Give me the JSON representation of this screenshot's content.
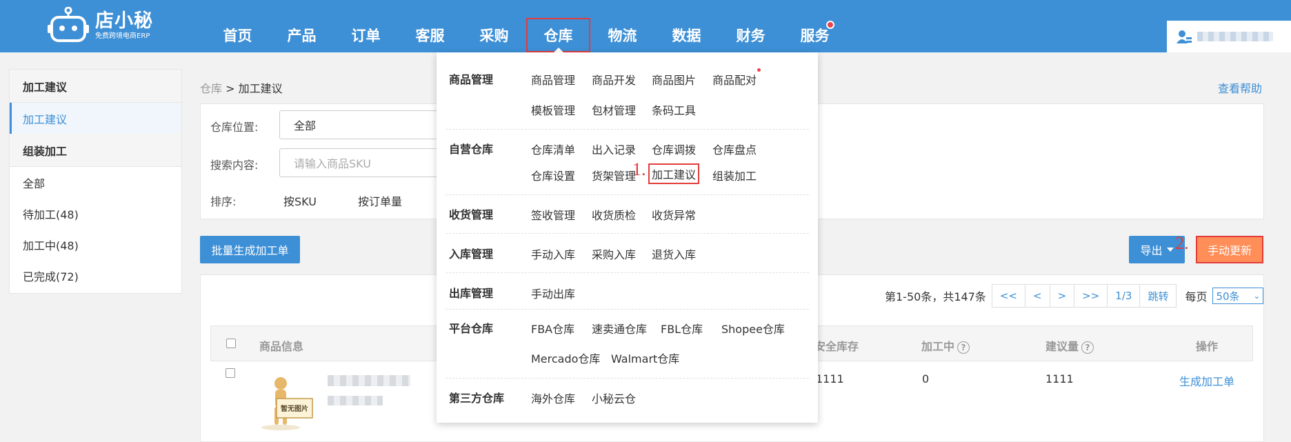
{
  "app": {
    "logo_title": "店小秘",
    "logo_subtitle": "免费跨境电商ERP"
  },
  "nav": {
    "items": [
      {
        "label": "首页"
      },
      {
        "label": "产品"
      },
      {
        "label": "订单"
      },
      {
        "label": "客服"
      },
      {
        "label": "采购"
      },
      {
        "label": "仓库",
        "active": true
      },
      {
        "label": "物流"
      },
      {
        "label": "数据"
      },
      {
        "label": "财务"
      },
      {
        "label": "服务",
        "has_dot": true
      }
    ]
  },
  "sidebar": {
    "section1_title": "加工建议",
    "item_processing_suggestion": "加工建议",
    "section2_title": "组装加工",
    "item_all": "全部",
    "item_pending": "待加工(48)",
    "item_in_progress": "加工中(48)",
    "item_done": "已完成(72)"
  },
  "breadcrumb": {
    "parent": "仓库",
    "sep": " > ",
    "current": "加工建议"
  },
  "help_link": "查看帮助",
  "filters": {
    "location_label": "仓库位置:",
    "location_value": "全部",
    "search_label": "搜索内容:",
    "search_placeholder": "请输入商品SKU",
    "sort_label": "排序:",
    "sort_by_sku": "按SKU",
    "sort_by_order": "按订单量"
  },
  "actions": {
    "batch_create": "批量生成加工单",
    "export": "导出",
    "manual_update": "手动更新",
    "annotation_1": "1.",
    "annotation_2": "2."
  },
  "pager": {
    "summary": "第1-50条，共147条",
    "first": "<<",
    "prev": "<",
    "next": ">",
    "last": ">>",
    "page": "1/3",
    "jump": "跳转",
    "per_page_label": "每页",
    "per_page_value": "50条"
  },
  "table": {
    "headers": {
      "product_info": "商品信息",
      "safety_stock": "安全库存",
      "in_processing": "加工中",
      "suggested_qty": "建议量",
      "operation": "操作"
    },
    "rows": [
      {
        "no_image_text": "暂无图片",
        "safety_stock": "1111",
        "in_processing": "0",
        "suggested_qty": "1111",
        "action": "生成加工单"
      }
    ]
  },
  "dropdown": {
    "sections": {
      "product": {
        "title": "商品管理",
        "links": [
          "商品管理",
          "商品开发",
          "商品图片",
          "商品配对",
          "模板管理",
          "包材管理",
          "条码工具"
        ]
      },
      "self_warehouse": {
        "title": "自营仓库",
        "links": [
          "仓库清单",
          "出入记录",
          "仓库调拨",
          "仓库盘点",
          "仓库设置",
          "货架管理",
          "加工建议",
          "组装加工"
        ]
      },
      "receiving": {
        "title": "收货管理",
        "links": [
          "签收管理",
          "收货质检",
          "收货异常"
        ]
      },
      "inbound": {
        "title": "入库管理",
        "links": [
          "手动入库",
          "采购入库",
          "退货入库"
        ]
      },
      "outbound": {
        "title": "出库管理",
        "links": [
          "手动出库"
        ]
      },
      "platform": {
        "title": "平台仓库",
        "links": [
          "FBA仓库",
          "速卖通仓库",
          "FBL仓库",
          "Shopee仓库",
          "Mercado仓库",
          "Walmart仓库"
        ]
      },
      "third_party": {
        "title": "第三方仓库",
        "links": [
          "海外仓库",
          "小秘云仓"
        ]
      }
    }
  },
  "colors": {
    "brand_blue": "#3d8fd6",
    "highlight_red": "#e43b3b",
    "orange": "#ff8e59"
  }
}
